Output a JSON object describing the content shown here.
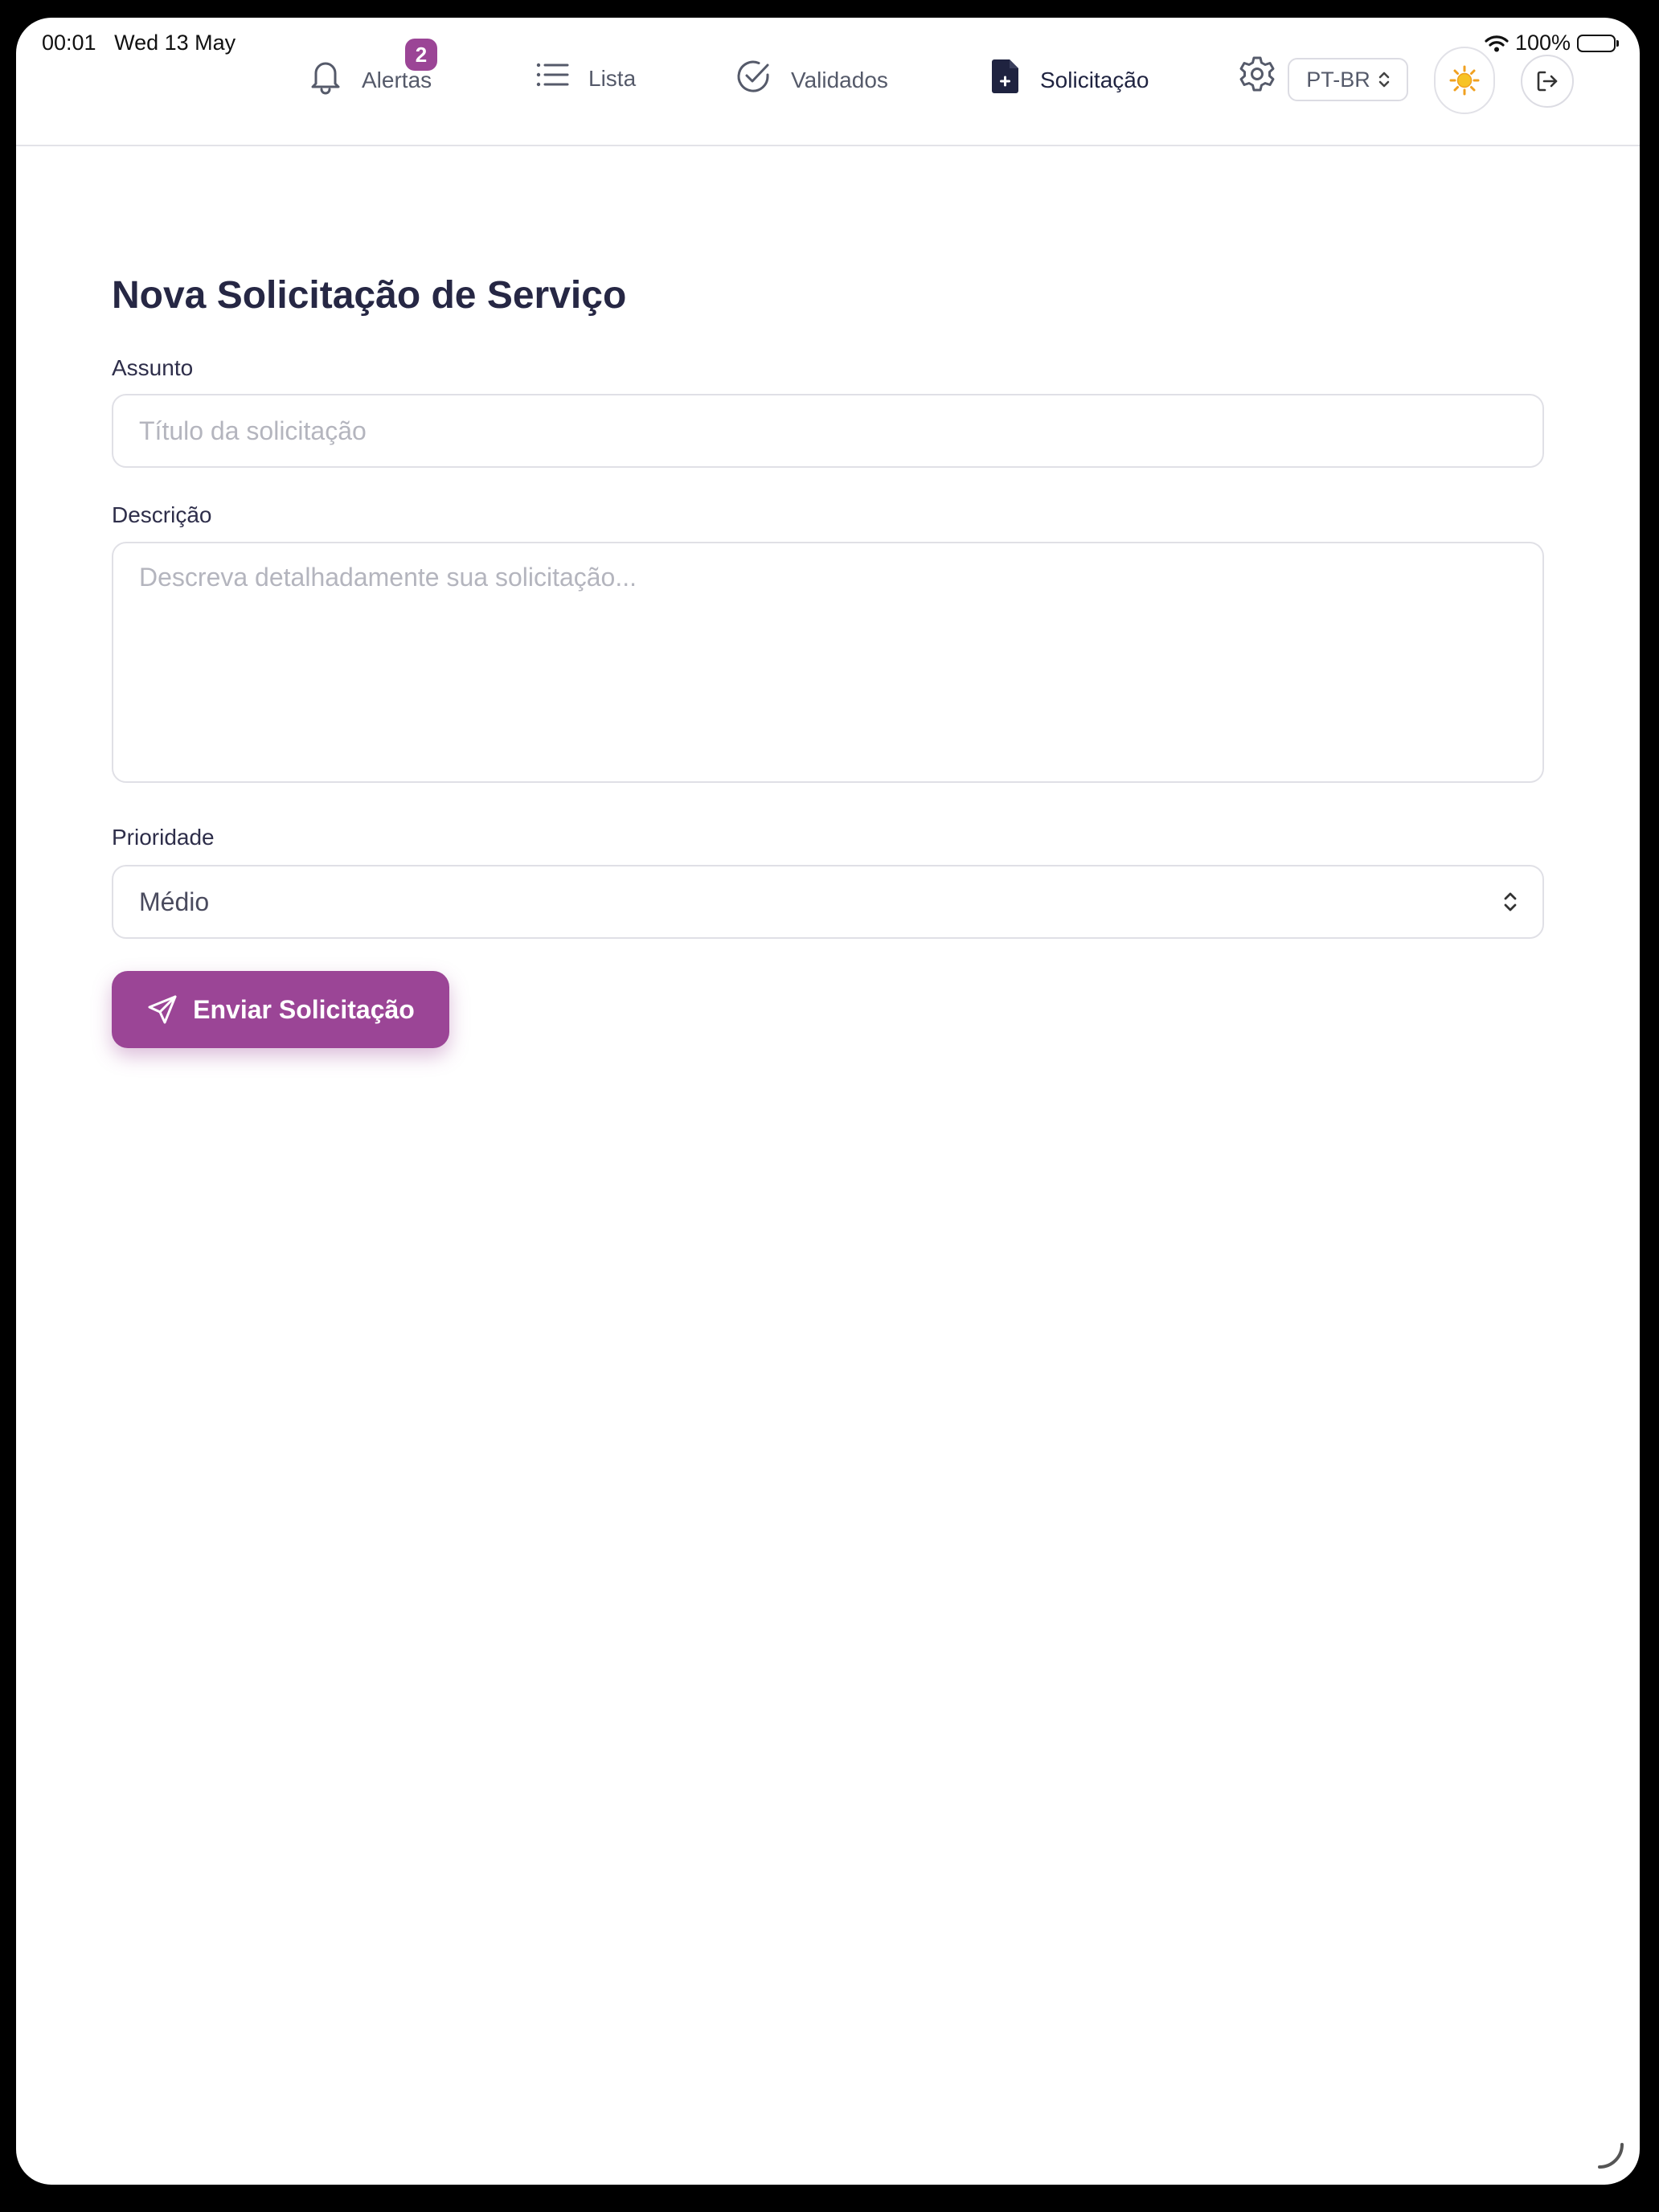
{
  "status_bar": {
    "time": "00:01",
    "date": "Wed 13 May",
    "battery": "100%"
  },
  "nav": {
    "items": [
      {
        "label": "Alertas",
        "icon": "bell-icon",
        "badge": "2"
      },
      {
        "label": "Lista",
        "icon": "list-icon"
      },
      {
        "label": "Validados",
        "icon": "check-circle-icon"
      },
      {
        "label": "Solicitação",
        "icon": "file-plus-icon",
        "active": true
      }
    ],
    "language": "PT-BR"
  },
  "form": {
    "title": "Nova Solicitação de Serviço",
    "subject_label": "Assunto",
    "subject_placeholder": "Título da solicitação",
    "description_label": "Descrição",
    "description_placeholder": "Descreva detalhadamente sua solicitação...",
    "priority_label": "Prioridade",
    "priority_value": "Médio",
    "submit_label": "Enviar Solicitação"
  },
  "colors": {
    "accent": "#9b4596",
    "title": "#262744"
  }
}
